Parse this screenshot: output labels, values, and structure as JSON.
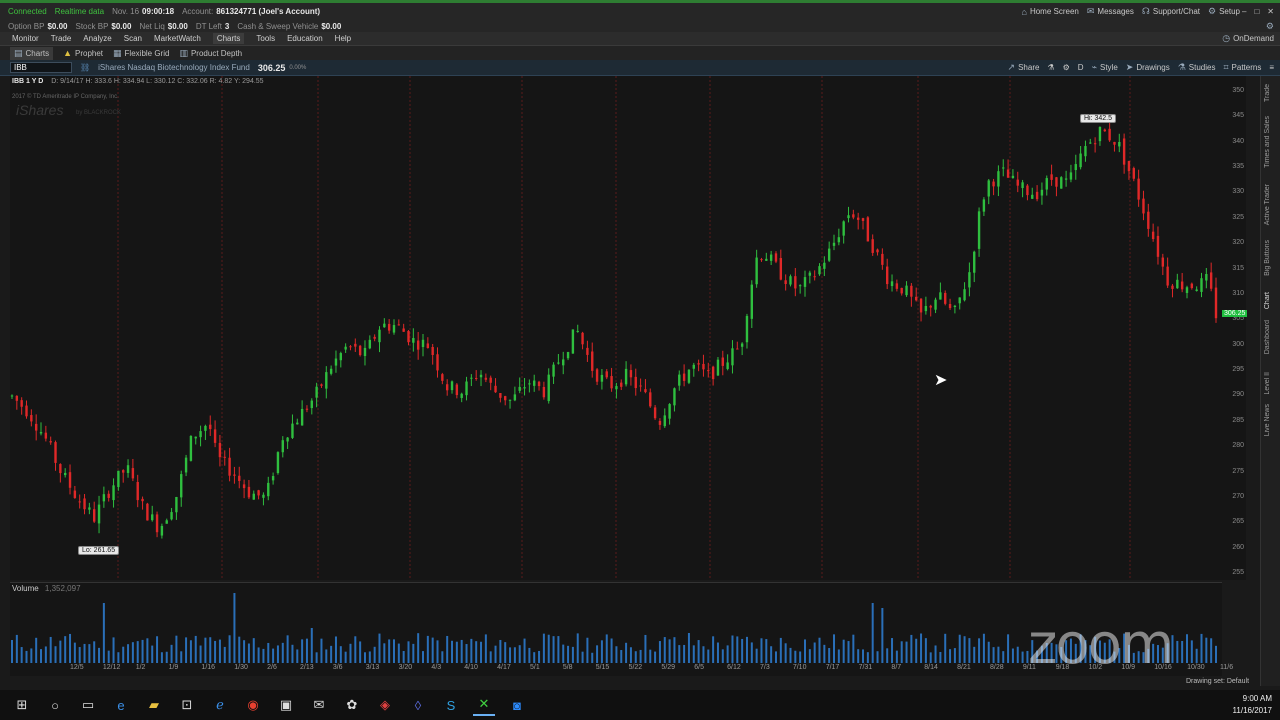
{
  "status_bar": {
    "connected": "Connected",
    "realtime": "Realtime data",
    "date_label": "Nov. 16",
    "time": "09:00:18",
    "account_label": "Account:",
    "account_value": "861324771 (Joel's Account)",
    "home": "Home Screen",
    "messages": "Messages",
    "support": "Support/Chat",
    "setup": "Setup"
  },
  "account_bar": {
    "items": [
      {
        "label": "Option BP",
        "value": "$0.00"
      },
      {
        "label": "Stock BP",
        "value": "$0.00"
      },
      {
        "label": "Net Liq",
        "value": "$0.00"
      },
      {
        "label": "DT Left",
        "value": "3"
      },
      {
        "label": "Cash & Sweep Vehicle",
        "value": "$0.00"
      }
    ]
  },
  "menu": {
    "items": [
      "Monitor",
      "Trade",
      "Analyze",
      "Scan",
      "MarketWatch",
      "Charts",
      "Tools",
      "Education",
      "Help"
    ],
    "ondemand": "OnDemand"
  },
  "sub_menu": {
    "items": [
      "Charts",
      "Prophet",
      "Flexible Grid",
      "Product Depth"
    ]
  },
  "symbol_bar": {
    "symbol": "IBB",
    "description": "iShares Nasdaq Biotechnology Index Fund",
    "price": "306.25",
    "change": "0.00%",
    "share": "Share",
    "interval": "D",
    "style": "Style",
    "drawings": "Drawings",
    "studies": "Studies",
    "patterns": "Patterns"
  },
  "chart": {
    "header": "IBB 1 Y D",
    "ohlc": "D: 9/14/17  H: 333.6  H: 334.94  L: 330.12  C: 332.06  R: 4.82  Y: 294.55",
    "company": "2017 © TD Ameritrade IP Company, Inc.",
    "logo": "iShares",
    "logo_sub": "by BLACKROCK",
    "hi_label": "Hi: 342.5",
    "lo_label": "Lo: 261.65",
    "last_price": "306.25",
    "price_ticks": [
      "350",
      "345",
      "340",
      "335",
      "330",
      "325",
      "320",
      "315",
      "310",
      "305",
      "300",
      "295",
      "290",
      "285",
      "280",
      "275",
      "270",
      "265",
      "260",
      "255"
    ],
    "volume_label": "Volume",
    "volume_value": "1,352,097",
    "x_labels": [
      "12/5",
      "12/12",
      "1/2",
      "1/9",
      "1/16",
      "1/30",
      "2/6",
      "2/13",
      "3/6",
      "3/13",
      "3/20",
      "4/3",
      "4/10",
      "4/17",
      "5/1",
      "5/8",
      "5/15",
      "5/22",
      "5/29",
      "6/5",
      "6/12",
      "7/3",
      "7/10",
      "7/17",
      "7/31",
      "8/7",
      "8/14",
      "8/21",
      "8/28",
      "9/11",
      "9/18",
      "10/2",
      "10/9",
      "10/16",
      "10/30",
      "11/6"
    ],
    "drawing_set": "Drawing set: Default"
  },
  "chart_data": {
    "type": "candlestick",
    "title": "IBB 1 Y D",
    "ylim": [
      255,
      350
    ],
    "price_path": [
      [
        0,
        290
      ],
      [
        2,
        287
      ],
      [
        4,
        282
      ],
      [
        6,
        275
      ],
      [
        8,
        270
      ],
      [
        10,
        266
      ],
      [
        12,
        272
      ],
      [
        14,
        276
      ],
      [
        16,
        268
      ],
      [
        18,
        264
      ],
      [
        20,
        270
      ],
      [
        22,
        282
      ],
      [
        24,
        285
      ],
      [
        25,
        278
      ],
      [
        27,
        275
      ],
      [
        29,
        271
      ],
      [
        31,
        270
      ],
      [
        33,
        282
      ],
      [
        35,
        286
      ],
      [
        37,
        290
      ],
      [
        39,
        296
      ],
      [
        41,
        300
      ],
      [
        43,
        298
      ],
      [
        45,
        304
      ],
      [
        47,
        304
      ],
      [
        49,
        301
      ],
      [
        51,
        300
      ],
      [
        53,
        292
      ],
      [
        55,
        291
      ],
      [
        57,
        295
      ],
      [
        59,
        291
      ],
      [
        61,
        289
      ],
      [
        63,
        293
      ],
      [
        65,
        291
      ],
      [
        67,
        298
      ],
      [
        69,
        303
      ],
      [
        71,
        295
      ],
      [
        73,
        292
      ],
      [
        75,
        294
      ],
      [
        77,
        291
      ],
      [
        79,
        285
      ],
      [
        81,
        292
      ],
      [
        83,
        296
      ],
      [
        85,
        294
      ],
      [
        87,
        297
      ],
      [
        89,
        300
      ],
      [
        90,
        310
      ],
      [
        91,
        318
      ],
      [
        92,
        318
      ],
      [
        94,
        314
      ],
      [
        96,
        311
      ],
      [
        98,
        314
      ],
      [
        100,
        319
      ],
      [
        102,
        326
      ],
      [
        103,
        326
      ],
      [
        105,
        320
      ],
      [
        107,
        313
      ],
      [
        109,
        311
      ],
      [
        111,
        306
      ],
      [
        113,
        310
      ],
      [
        115,
        306
      ],
      [
        117,
        315
      ],
      [
        118,
        325
      ],
      [
        119,
        332
      ],
      [
        121,
        334
      ],
      [
        123,
        331
      ],
      [
        125,
        330
      ],
      [
        127,
        333
      ],
      [
        129,
        332
      ],
      [
        131,
        339
      ],
      [
        133,
        342.5
      ],
      [
        135,
        340
      ],
      [
        137,
        332
      ],
      [
        139,
        323
      ],
      [
        141,
        313
      ],
      [
        143,
        312
      ],
      [
        145,
        312
      ],
      [
        146,
        313
      ],
      [
        147,
        306.25
      ]
    ],
    "volume_note": "daily volume bars, spikes near Jan and Jun",
    "hi": 342.5,
    "lo": 261.65,
    "last": 306.25
  },
  "side_tabs": [
    "Trade",
    "Times and Sales",
    "Active Trader",
    "Big Buttons",
    "Chart",
    "Dashboard",
    "Level II",
    "Live News"
  ],
  "watermark": "zoom",
  "taskbar": {
    "time": "9:00 AM",
    "date": "11/16/2017"
  }
}
